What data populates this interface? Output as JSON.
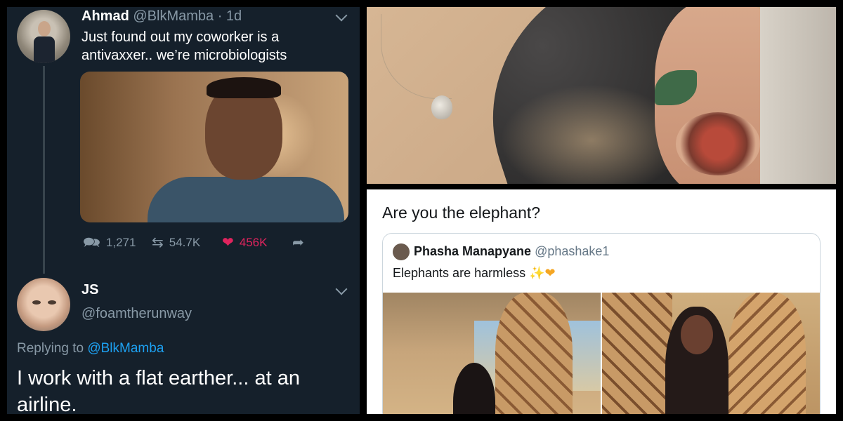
{
  "tweet": {
    "author_name": "Ahmad",
    "author_handle": "@BlkMamba",
    "time": "· 1d",
    "text_line1": "Just found out my coworker is a",
    "text_line2": "antivaxxer.. we’re microbiologists",
    "replies": "1,271",
    "retweets": "54.7K",
    "likes": "456K",
    "icons": {
      "reply": "comment-icon",
      "retweet": "retweet-icon",
      "like": "heart-icon",
      "share": "share-icon",
      "menu": "chevron-down-icon"
    },
    "like_color": "#e0245e"
  },
  "reply": {
    "author_name": "JS",
    "author_handle": "@foamtherunway",
    "replying_to_label": "Replying to",
    "replying_to_handle": "@BlkMamba",
    "text": "I work with a flat earther... at an airline."
  },
  "quote": {
    "text": "Are you the elephant?",
    "quoted_name": "Phasha Manapyane",
    "quoted_handle": "@phashake1",
    "quoted_text": "Elephants are harmless",
    "quoted_emojis": "✨❤"
  },
  "colors": {
    "tweet_bg": "#15202b",
    "link": "#1da1f2",
    "muted": "#8899a6"
  }
}
